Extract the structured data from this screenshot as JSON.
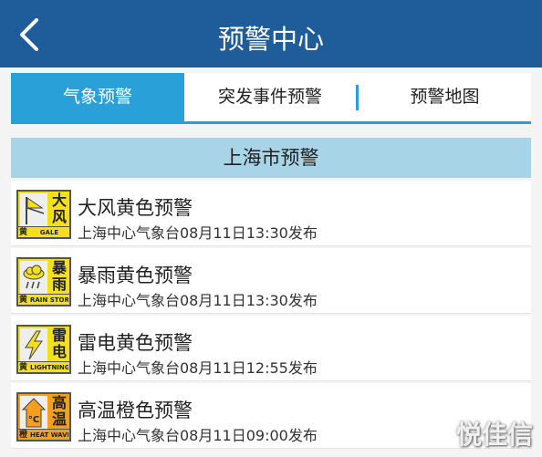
{
  "header": {
    "title": "预警中心",
    "back_icon": "chevron-left-icon"
  },
  "tabs": [
    {
      "label": "气象预警",
      "active": true
    },
    {
      "label": "突发事件预警",
      "active": false
    },
    {
      "label": "预警地图",
      "active": false
    }
  ],
  "region": "上海市预警",
  "warnings": [
    {
      "title": "大风黄色预警",
      "subtitle": "上海中心气象台08月11日13:30发布",
      "badge": {
        "cn": "大风",
        "level": "黄",
        "en": "GALE",
        "color": "#f3df1c",
        "icon": "flag-icon"
      }
    },
    {
      "title": "暴雨黄色预警",
      "subtitle": "上海中心气象台08月11日13:30发布",
      "badge": {
        "cn": "暴雨",
        "level": "黄",
        "en": "RAIN STORM",
        "color": "#f3df1c",
        "icon": "rain-cloud-icon"
      }
    },
    {
      "title": "雷电黄色预警",
      "subtitle": "上海中心气象台08月11日12:55发布",
      "badge": {
        "cn": "雷电",
        "level": "黄",
        "en": "LIGHTNING",
        "color": "#f3df1c",
        "icon": "lightning-icon"
      }
    },
    {
      "title": "高温橙色预警",
      "subtitle": "上海中心气象台08月11日09:00发布",
      "badge": {
        "cn": "高温",
        "level": "橙",
        "en": "HEAT WAVE",
        "color": "#f3a01c",
        "icon": "thermometer-icon",
        "pic_text": "°C"
      }
    }
  ],
  "watermark": "悦佳信"
}
